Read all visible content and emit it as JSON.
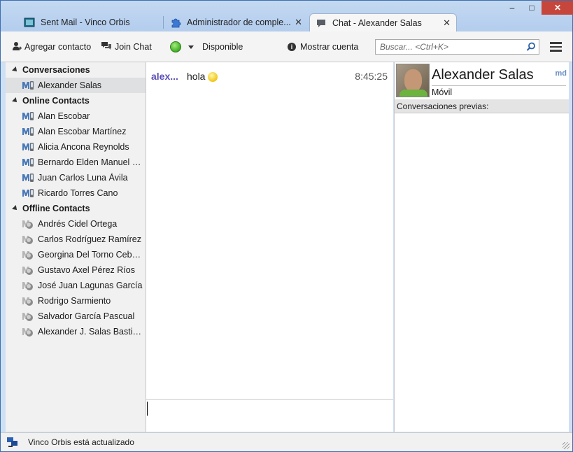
{
  "window": {
    "controls": {
      "minimize": "–",
      "maximize": "□",
      "close": "✕"
    }
  },
  "tabs": [
    {
      "label": "Sent Mail - Vinco Orbis",
      "icon": "mail-window-icon",
      "active": false
    },
    {
      "label": "Administrador de comple...",
      "icon": "puzzle-icon",
      "active": false,
      "close": "✕"
    },
    {
      "label": "Chat - Alexander Salas",
      "icon": "chat-bubble-icon",
      "active": true,
      "close": "✕"
    }
  ],
  "toolbar": {
    "add_contact": "Agregar contacto",
    "join_chat": "Join Chat",
    "status": "Disponible",
    "status_color": "#4cb830",
    "show_account": "Mostrar cuenta",
    "search_placeholder": "Buscar... <Ctrl+K>"
  },
  "contacts": {
    "conversations_label": "Conversaciones",
    "conversations": [
      "Alexander Salas"
    ],
    "online_label": "Online Contacts",
    "online": [
      "Alan Escobar",
      "Alan Escobar Martínez",
      "Alicia Ancona Reynolds",
      "Bernardo Elden Manuel B...",
      "Juan Carlos Luna Ávila",
      "Ricardo Torres Cano"
    ],
    "offline_label": "Offline Contacts",
    "offline": [
      "Andrés Cidel Ortega",
      "Carlos Rodríguez Ramírez",
      "Georgina Del Torno Cebal...",
      "Gustavo Axel Pérez Ríos",
      "José Juan Lagunas García",
      "Rodrigo Sarmiento",
      "Salvador García Pascual",
      "Alexander J. Salas Bastidas"
    ]
  },
  "chat": {
    "messages": [
      {
        "sender": "alex...",
        "text": "hola",
        "time": "8:45:25"
      }
    ]
  },
  "info": {
    "name": "Alexander Salas",
    "status": "Móvil",
    "logo": "md",
    "previous_label": "Conversaciones previas:"
  },
  "statusbar": {
    "text": "Vinco Orbis está actualizado"
  },
  "colors": {
    "sender": "#5b4fb5",
    "titlebar": "#b9d1ef"
  }
}
